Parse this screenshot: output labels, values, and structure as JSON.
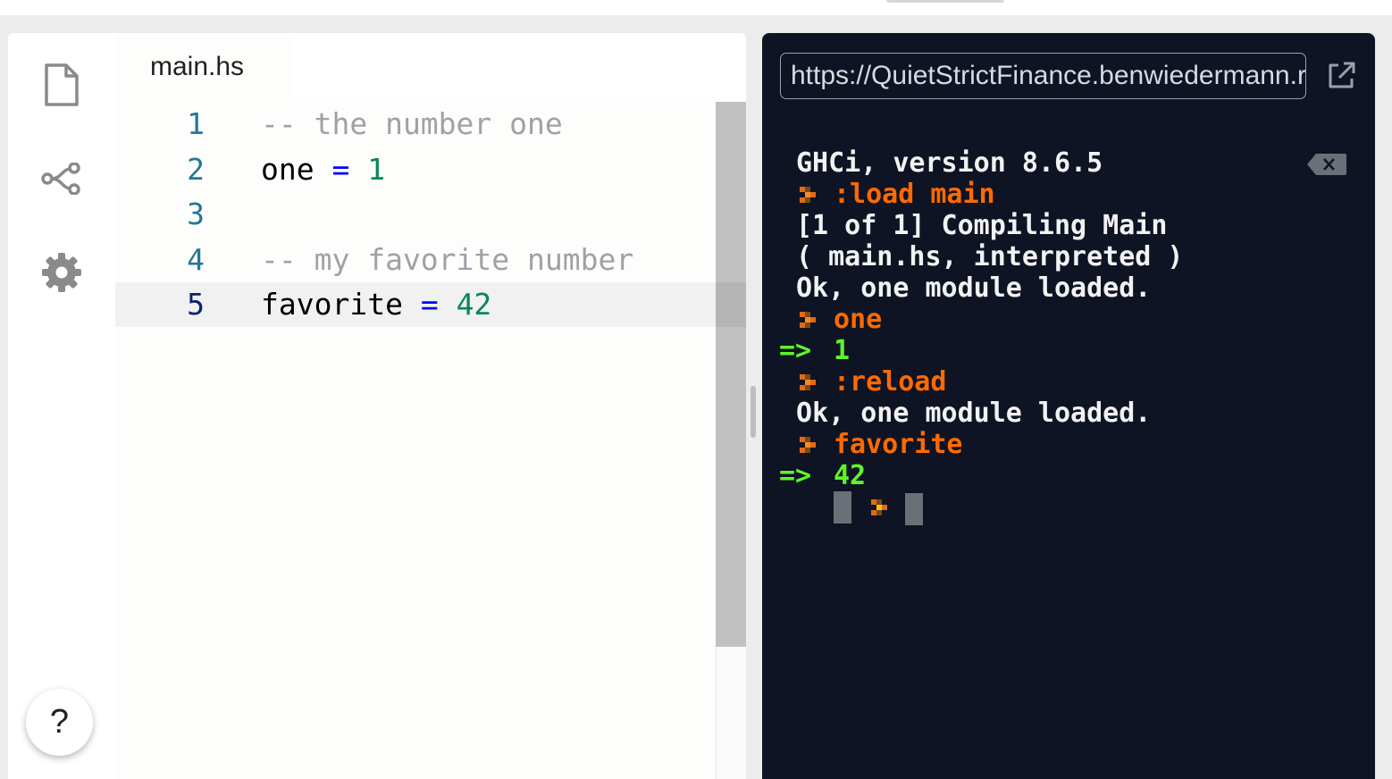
{
  "editor": {
    "tab_label": "main.hs",
    "lines": [
      {
        "num": "1",
        "tokens": [
          {
            "t": "-- the number one",
            "k": "comment"
          }
        ]
      },
      {
        "num": "2",
        "tokens": [
          {
            "t": "one ",
            "k": "plain"
          },
          {
            "t": "=",
            "k": "op"
          },
          {
            "t": " ",
            "k": "plain"
          },
          {
            "t": "1",
            "k": "num"
          }
        ]
      },
      {
        "num": "3",
        "tokens": []
      },
      {
        "num": "4",
        "tokens": [
          {
            "t": "-- my favorite number",
            "k": "comment"
          }
        ]
      },
      {
        "num": "5",
        "tokens": [
          {
            "t": "favorite ",
            "k": "plain"
          },
          {
            "t": "=",
            "k": "op"
          },
          {
            "t": " ",
            "k": "plain"
          },
          {
            "t": "42",
            "k": "num"
          }
        ]
      }
    ],
    "active_line": "5"
  },
  "sidebar": {
    "items": [
      {
        "name": "file-icon",
        "icon": "file"
      },
      {
        "name": "share-icon",
        "icon": "share"
      },
      {
        "name": "gear-icon",
        "icon": "gear"
      }
    ],
    "help_label": "?"
  },
  "terminal": {
    "url": "https://QuietStrictFinance.benwiedermann.repl.run",
    "lines": [
      {
        "kind": "output",
        "text": "GHCi, version 8.6.5"
      },
      {
        "kind": "input",
        "text": ":load main"
      },
      {
        "kind": "output",
        "text": "[1 of 1] Compiling Main"
      },
      {
        "kind": "output",
        "text": "( main.hs, interpreted )"
      },
      {
        "kind": "output",
        "text": "Ok, one module loaded."
      },
      {
        "kind": "input",
        "text": "one"
      },
      {
        "kind": "result",
        "arrow": "=>",
        "text": "1"
      },
      {
        "kind": "input",
        "text": ":reload"
      },
      {
        "kind": "output",
        "text": "Ok, one module loaded."
      },
      {
        "kind": "input",
        "text": "favorite"
      },
      {
        "kind": "result",
        "arrow": "=>",
        "text": "42"
      },
      {
        "kind": "cursor",
        "text": ""
      }
    ]
  },
  "colors": {
    "terminal_bg": "#0e1424",
    "prompt_orange": "#ff6a00",
    "result_green": "#5df52a",
    "line_number": "#237893",
    "keyword_op": "#0000ff",
    "number": "#098658"
  }
}
